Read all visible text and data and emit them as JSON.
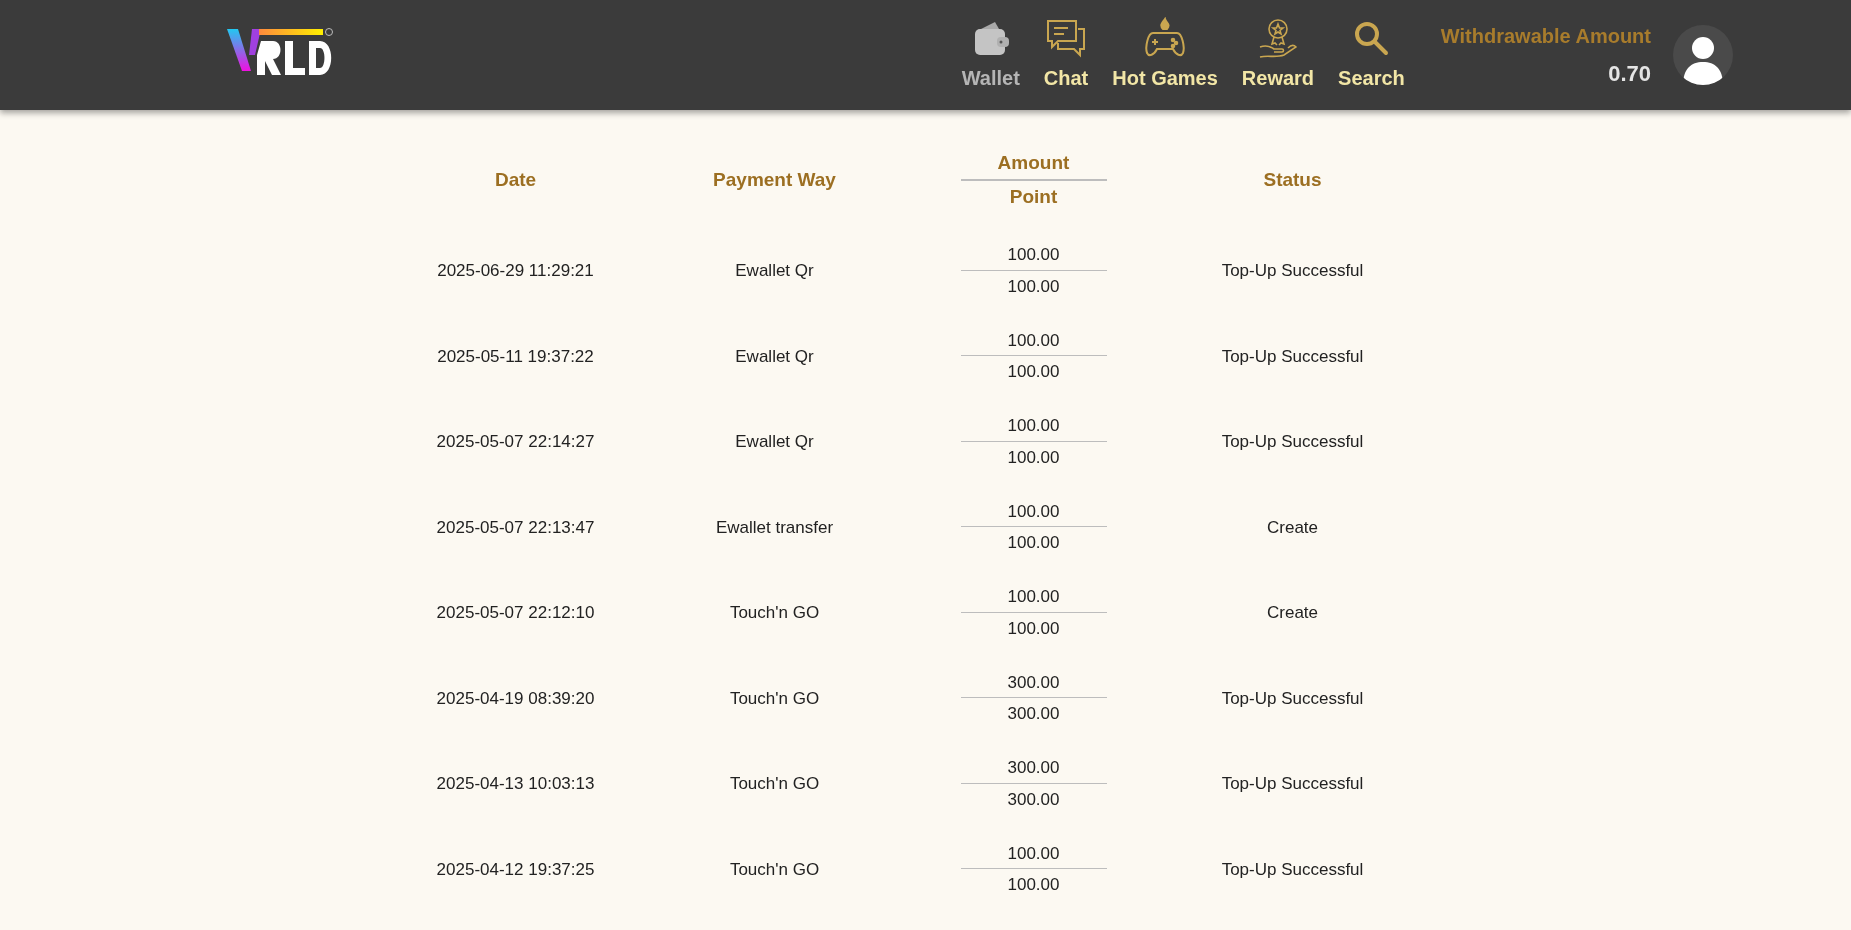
{
  "header": {
    "nav": [
      {
        "kind": "wallet",
        "label": "Wallet",
        "selected": true
      },
      {
        "kind": "chat",
        "label": "Chat",
        "selected": false
      },
      {
        "kind": "games",
        "label": "Hot Games",
        "selected": false
      },
      {
        "kind": "reward",
        "label": "Reward",
        "selected": false
      },
      {
        "kind": "search",
        "label": "Search",
        "selected": false
      }
    ],
    "balance": {
      "label": "Withdrawable Amount",
      "value": "0.70"
    }
  },
  "table": {
    "columns": {
      "date": "Date",
      "payment": "Payment Way",
      "amount": "Amount",
      "point": "Point",
      "status": "Status"
    },
    "rows": [
      {
        "date": "2025-06-29 11:29:21",
        "payment": "Ewallet Qr",
        "amount": "100.00",
        "point": "100.00",
        "status": "Top-Up Successful"
      },
      {
        "date": "2025-05-11 19:37:22",
        "payment": "Ewallet Qr",
        "amount": "100.00",
        "point": "100.00",
        "status": "Top-Up Successful"
      },
      {
        "date": "2025-05-07 22:14:27",
        "payment": "Ewallet Qr",
        "amount": "100.00",
        "point": "100.00",
        "status": "Top-Up Successful"
      },
      {
        "date": "2025-05-07 22:13:47",
        "payment": "Ewallet transfer",
        "amount": "100.00",
        "point": "100.00",
        "status": "Create"
      },
      {
        "date": "2025-05-07 22:12:10",
        "payment": "Touch'n GO",
        "amount": "100.00",
        "point": "100.00",
        "status": "Create"
      },
      {
        "date": "2025-04-19 08:39:20",
        "payment": "Touch'n GO",
        "amount": "300.00",
        "point": "300.00",
        "status": "Top-Up Successful"
      },
      {
        "date": "2025-04-13 10:03:13",
        "payment": "Touch'n GO",
        "amount": "300.00",
        "point": "300.00",
        "status": "Top-Up Successful"
      },
      {
        "date": "2025-04-12 19:37:25",
        "payment": "Touch'n GO",
        "amount": "100.00",
        "point": "100.00",
        "status": "Top-Up Successful"
      }
    ]
  }
}
